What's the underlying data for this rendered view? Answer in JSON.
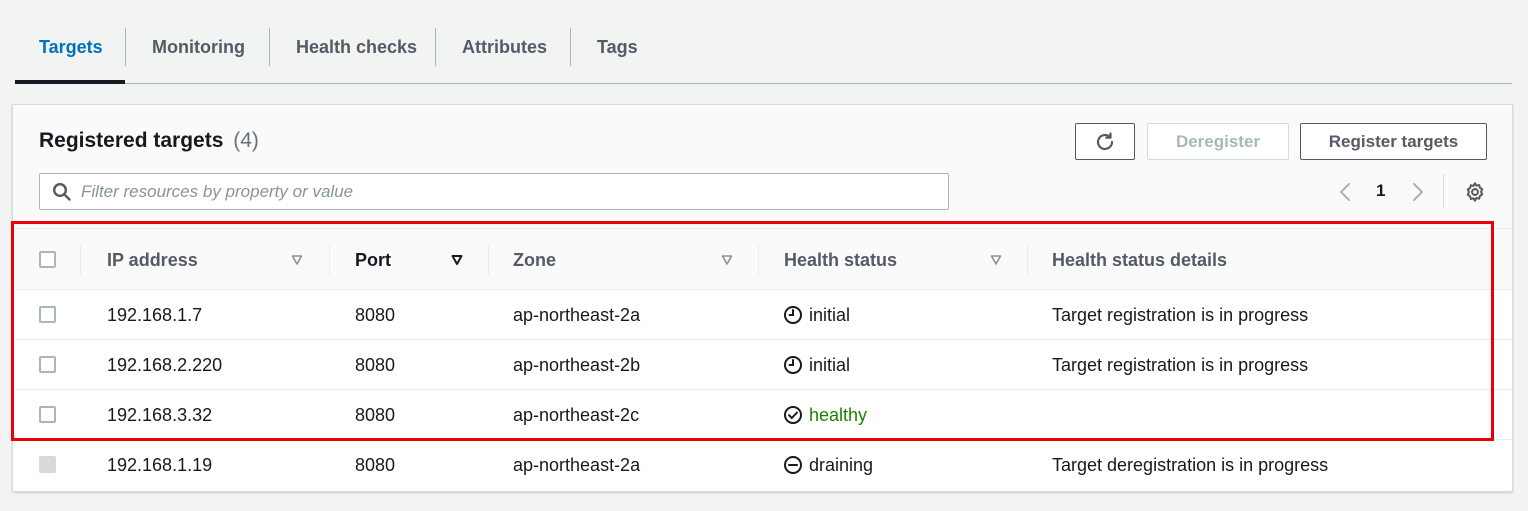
{
  "tabs": [
    {
      "label": "Targets",
      "active": true
    },
    {
      "label": "Monitoring",
      "active": false
    },
    {
      "label": "Health checks",
      "active": false
    },
    {
      "label": "Attributes",
      "active": false
    },
    {
      "label": "Tags",
      "active": false
    }
  ],
  "panel": {
    "title": "Registered targets",
    "count": "(4)",
    "refresh_icon": "refresh-icon",
    "deregister_label": "Deregister",
    "register_label": "Register targets",
    "search_placeholder": "Filter resources by property or value",
    "search_value": "",
    "page_number": "1"
  },
  "columns": {
    "ip": "IP address",
    "port": "Port",
    "zone": "Zone",
    "health": "Health status",
    "details": "Health status details"
  },
  "rows": [
    {
      "ip": "192.168.1.7",
      "port": "8080",
      "zone": "ap-northeast-2a",
      "status": "initial",
      "status_icon": "clock-icon",
      "details": "Target registration is in progress",
      "disabled": false
    },
    {
      "ip": "192.168.2.220",
      "port": "8080",
      "zone": "ap-northeast-2b",
      "status": "initial",
      "status_icon": "clock-icon",
      "details": "Target registration is in progress",
      "disabled": false
    },
    {
      "ip": "192.168.3.32",
      "port": "8080",
      "zone": "ap-northeast-2c",
      "status": "healthy",
      "status_icon": "check-circle-icon",
      "details": "",
      "disabled": false
    },
    {
      "ip": "192.168.1.19",
      "port": "8080",
      "zone": "ap-northeast-2a",
      "status": "draining",
      "status_icon": "minus-circle-icon",
      "details": "Target deregistration is in progress",
      "disabled": true
    }
  ],
  "colors": {
    "active_tab": "#0073bb",
    "healthy": "#1d8102",
    "highlight_border": "#e8000b"
  }
}
